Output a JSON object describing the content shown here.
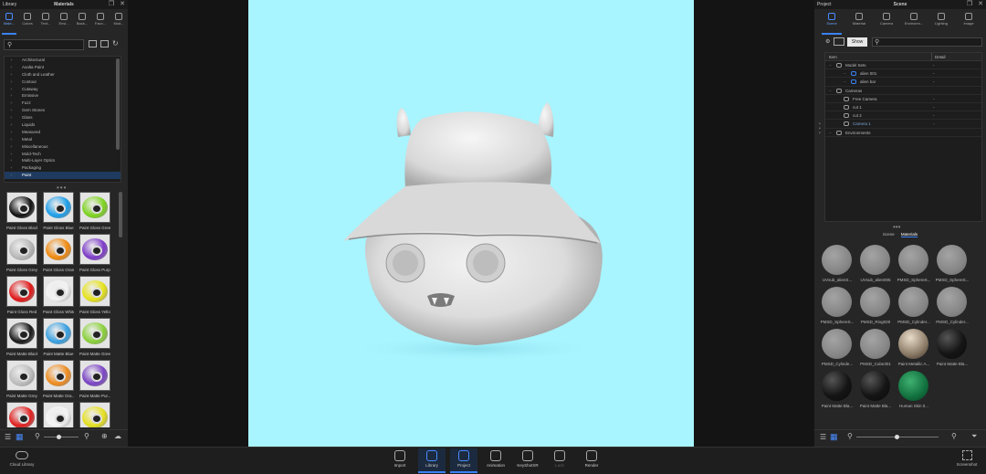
{
  "library": {
    "title_left": "Library",
    "title_center": "Materials",
    "tabs": [
      "Mate...",
      "Colors",
      "Text...",
      "Envi...",
      "Back...",
      "Favo...",
      "Mod..."
    ],
    "categories": [
      "Architectural",
      "Axalta Paint",
      "Cloth and Leather",
      "Contour",
      "Cutaway",
      "Emissive",
      "Fuzz",
      "Gem Stones",
      "Glass",
      "Liquids",
      "Measured",
      "Metal",
      "Miscellaneous",
      "Mold-Tech",
      "Multi-Layer Optics",
      "Packaging",
      "Paint"
    ],
    "materials": [
      {
        "label": "Paint Gloss Black",
        "color": "#111111"
      },
      {
        "label": "Paint Gloss Blue",
        "color": "#1e9ee8"
      },
      {
        "label": "Paint Gloss Green",
        "color": "#7ed321"
      },
      {
        "label": "Paint Gloss Grey",
        "color": "#b8b8b8"
      },
      {
        "label": "Paint Gloss Oran...",
        "color": "#f08a10"
      },
      {
        "label": "Paint Gloss Purple",
        "color": "#7d3cc8"
      },
      {
        "label": "Paint Gloss Red",
        "color": "#e01818"
      },
      {
        "label": "Paint Gloss White",
        "color": "#f2f2f2"
      },
      {
        "label": "Paint Gloss Yellow",
        "color": "#e6e21a"
      },
      {
        "label": "Paint Matte Black",
        "color": "#1a1a1a"
      },
      {
        "label": "Paint Matte Blue",
        "color": "#3aa0e0"
      },
      {
        "label": "Paint Matte Green",
        "color": "#8ad03a"
      },
      {
        "label": "Paint Matte Grey",
        "color": "#bdbdbd"
      },
      {
        "label": "Paint Matte Ora...",
        "color": "#ee8c20"
      },
      {
        "label": "Paint Matte Pur...",
        "color": "#7a44c4"
      },
      {
        "label": "",
        "color": "#e02020"
      },
      {
        "label": "",
        "color": "#f4f4f4"
      },
      {
        "label": "",
        "color": "#e6e020"
      }
    ],
    "cloud_label": "Cloud Library"
  },
  "project": {
    "title_left": "Project",
    "title_center": "Scene",
    "tabs": [
      "Scene",
      "Material",
      "Camera",
      "Environm...",
      "Lighting",
      "Image"
    ],
    "show_label": "Show",
    "col_item": "Item",
    "col_detail": "Detail",
    "tree": [
      {
        "label": "Model Sets",
        "detail": "-",
        "indent": 0
      },
      {
        "label": "alien 001",
        "detail": "-",
        "indent": 2
      },
      {
        "label": "alien bar",
        "detail": "-",
        "indent": 2
      },
      {
        "label": "Cameras",
        "detail": "",
        "indent": 0
      },
      {
        "label": "Free Camera",
        "detail": "-",
        "indent": 1
      },
      {
        "label": "cut 1",
        "detail": "-",
        "indent": 1
      },
      {
        "label": "cut 2",
        "detail": "-",
        "indent": 1
      },
      {
        "label": "Camera 1",
        "detail": "-",
        "indent": 1
      },
      {
        "label": "Environments",
        "detail": "",
        "indent": 0
      }
    ],
    "sub_tabs": [
      "Scene",
      "Materials"
    ],
    "materials": [
      {
        "label": "UVsub_alienS...",
        "type": "grey"
      },
      {
        "label": "UVsub_alien005",
        "type": "grey"
      },
      {
        "label": "PMSD_SphereS...",
        "type": "grey"
      },
      {
        "label": "PMSD_SphereS...",
        "type": "grey"
      },
      {
        "label": "PMSD_SphereS...",
        "type": "grey"
      },
      {
        "label": "PMSD_Ring029",
        "type": "grey"
      },
      {
        "label": "PMSD_Cylinder...",
        "type": "grey"
      },
      {
        "label": "PMSD_Cylinder...",
        "type": "grey"
      },
      {
        "label": "PMSD_Cylinde...",
        "type": "grey"
      },
      {
        "label": "PMSD_Cube301",
        "type": "grey"
      },
      {
        "label": "Paint Metallic A...",
        "type": "metallic"
      },
      {
        "label": "Paint Matte Bla...",
        "type": "black"
      },
      {
        "label": "Paint Matte Bla...",
        "type": "black"
      },
      {
        "label": "Paint Matte Bla...",
        "type": "black"
      },
      {
        "label": "Human Skin 0...",
        "type": "green"
      }
    ]
  },
  "bottom": {
    "items": [
      "Import",
      "Library",
      "Project",
      "Animation",
      "KeyShotXR",
      "Lock",
      "Render"
    ],
    "screenshot": "Screenshot"
  },
  "viewport": {
    "bg": "#a8f4ff"
  }
}
